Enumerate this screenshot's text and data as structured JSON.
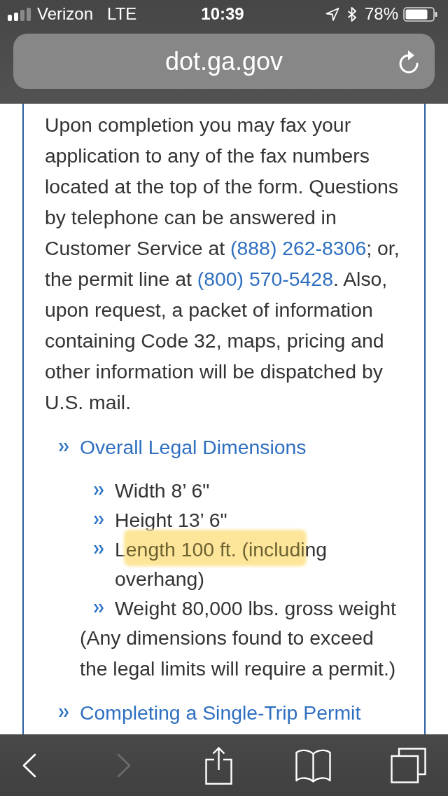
{
  "status_bar": {
    "carrier": "Verizon",
    "network": "LTE",
    "time": "10:39",
    "battery_percent": "78%"
  },
  "address_bar": {
    "url": "dot.ga.gov"
  },
  "article": {
    "intro": [
      {
        "kind": "text",
        "text": "Upon completion you may fax your application to any of the fax numbers located at the top of the form. Questions by telephone can be answered in Customer Service at "
      },
      {
        "kind": "link",
        "text": "(888) 262-8306"
      },
      {
        "kind": "text",
        "text": "; or, the permit line at "
      },
      {
        "kind": "link",
        "text": "(800) 570-5428"
      },
      {
        "kind": "text",
        "text": ". Also, upon request, a packet of information containing Code 32, maps, pricing and other information will be dispatched by U.S. mail."
      }
    ],
    "sections": [
      {
        "title": "Overall Legal Dimensions",
        "items": [
          {
            "runs": [
              {
                "text": "Width 8’ 6\"",
                "highlighted": false
              }
            ]
          },
          {
            "runs": [
              {
                "text": "Height 13’ 6\"",
                "highlighted": false
              }
            ]
          },
          {
            "runs": [
              {
                "text": "L",
                "highlighted": false
              },
              {
                "text": "ength 100 ft. (includi",
                "highlighted": true
              },
              {
                "text": "ng overhang)",
                "highlighted": false
              }
            ]
          },
          {
            "runs": [
              {
                "text": "Weight 80,000 lbs. gross weight",
                "highlighted": false
              }
            ]
          }
        ],
        "note": "(Any dimensions found to exceed the legal limits will require a permit.)"
      },
      {
        "title": "Completing a Single-Trip Permit"
      }
    ]
  },
  "toolbar": [
    {
      "kind": "back",
      "disabled": false
    },
    {
      "kind": "forward",
      "disabled": true
    },
    {
      "kind": "share",
      "disabled": false
    },
    {
      "kind": "bookmarks",
      "disabled": false
    },
    {
      "kind": "tabs",
      "disabled": false
    }
  ]
}
